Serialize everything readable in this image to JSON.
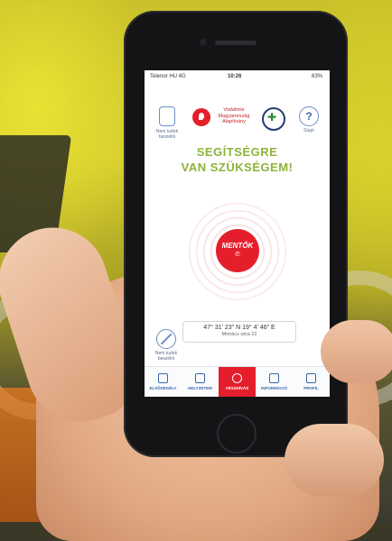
{
  "status_bar": {
    "carrier": "Telenor HU 4G",
    "time": "10:26",
    "battery": "63%"
  },
  "header": {
    "left_label": "Nem tudok beszélni",
    "org_name": "Vodafone Magyarország Alapítvány",
    "right_label": "Súgó",
    "right_icon_glyph": "?"
  },
  "headline": {
    "line1": "SEGÍTSÉGRE",
    "line2": "VAN SZÜKSÉGEM!"
  },
  "sos_button": {
    "label": "MENTŐK",
    "icon_glyph": "✆"
  },
  "location": {
    "left_label": "Nem tudok beszélni",
    "coordinates": "47° 31' 23\" N 19° 4' 46\" E",
    "address": "Mohács utca 22"
  },
  "tabs": [
    {
      "label": "ELSŐSEGÉLY",
      "icon": "first-aid-kit-icon",
      "active": false
    },
    {
      "label": "HELYZETEM",
      "icon": "target-icon",
      "active": false
    },
    {
      "label": "VÉSZHÍVÁS",
      "icon": "emergency-cross-icon",
      "active": true
    },
    {
      "label": "INFORMÁCIÓ",
      "icon": "info-icon",
      "active": false
    },
    {
      "label": "PROFIL",
      "icon": "user-icon",
      "active": false
    }
  ],
  "colors": {
    "accent_red": "#e41f2b",
    "headline_green": "#8fb23a",
    "icon_blue": "#3c66a8"
  }
}
